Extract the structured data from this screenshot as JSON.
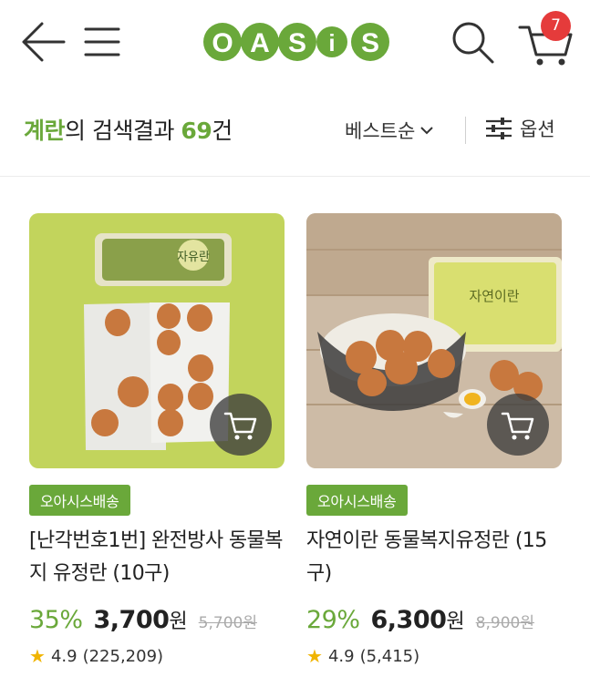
{
  "header": {
    "logo_text": "OASiS",
    "cart_count": "7",
    "icons": [
      "back-arrow-icon",
      "hamburger-menu-icon",
      "search-icon",
      "cart-icon"
    ]
  },
  "results": {
    "keyword": "계란",
    "suffix": "의 검색결과",
    "count": "69",
    "count_unit": "건",
    "sort_label": "베스트순",
    "option_label": "옵션"
  },
  "colors": {
    "brand_green": "#6aa83a",
    "badge_red": "#e53b3b"
  },
  "products": [
    {
      "badge": "오아시스배송",
      "title": "[난각번호1번] 완전방사 동물복지 유정란 (10구)",
      "discount": "35%",
      "price": "3,700",
      "won": "원",
      "original_price": "5,700원",
      "rating": "4.9",
      "reviews": "(225,209)",
      "package_label": "자유란"
    },
    {
      "badge": "오아시스배송",
      "title": "자연이란 동물복지유정란 (15구)",
      "discount": "29%",
      "price": "6,300",
      "won": "원",
      "original_price": "8,900원",
      "rating": "4.9",
      "reviews": "(5,415)",
      "package_label": "자연이란"
    }
  ]
}
